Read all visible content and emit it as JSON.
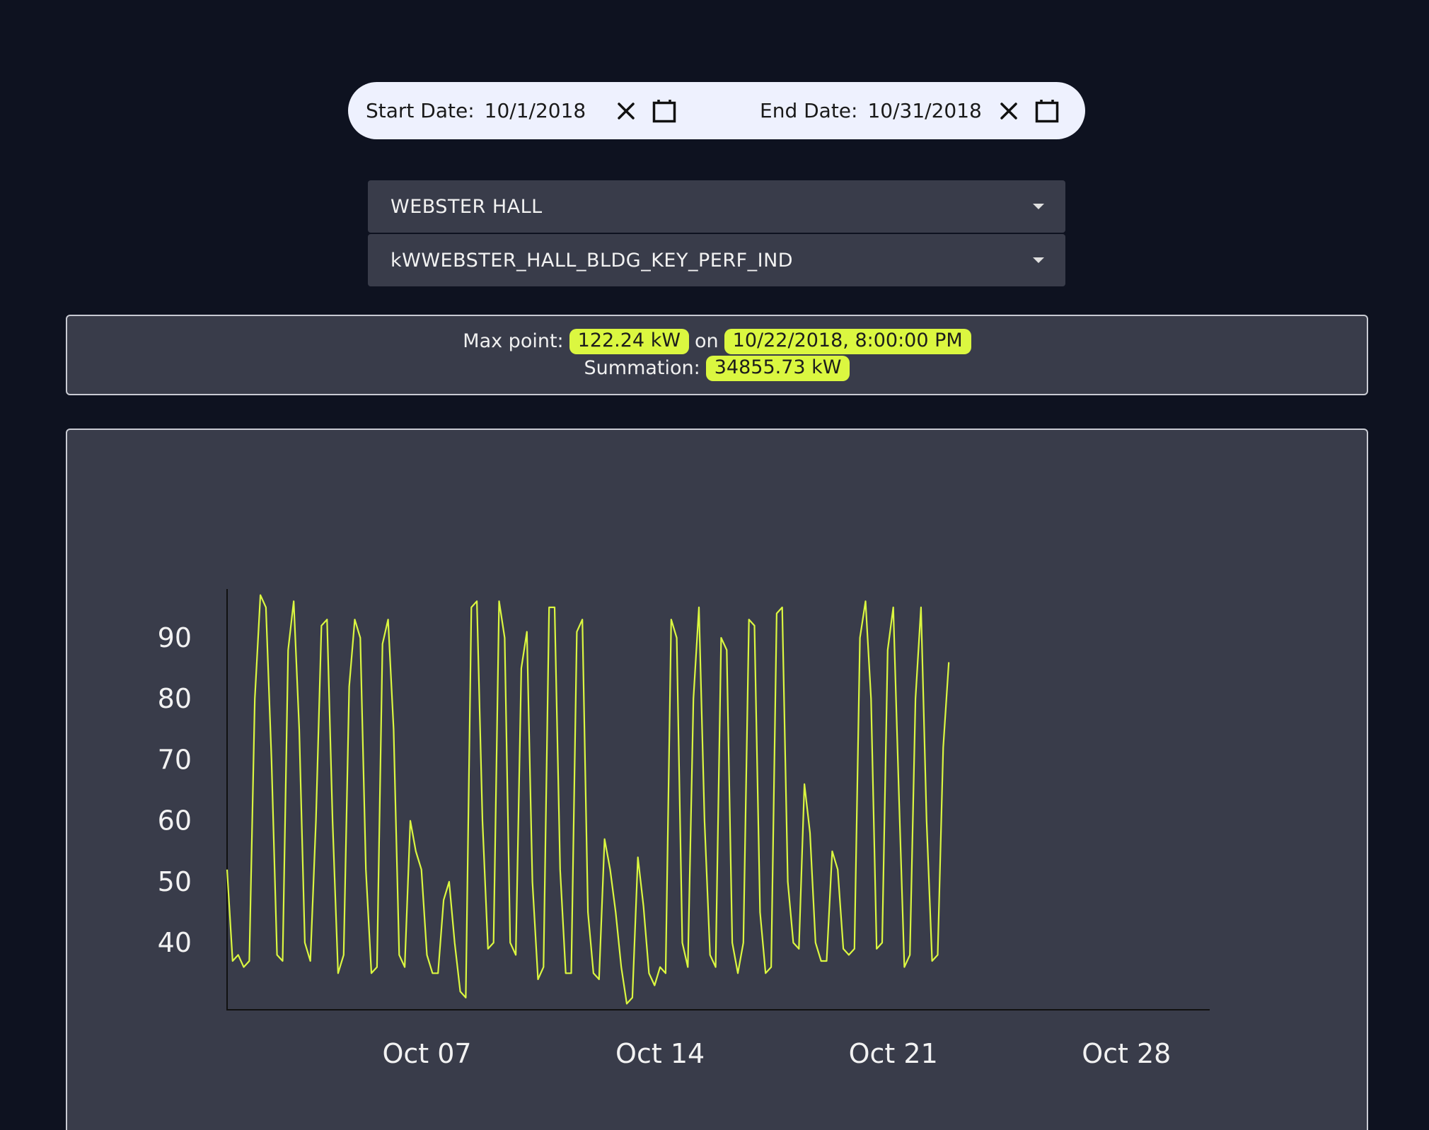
{
  "date_range": {
    "start_label": "Start Date:",
    "start_value": "10/1/2018",
    "end_label": "End Date:",
    "end_value": "10/31/2018",
    "icons": [
      "close-icon",
      "calendar-icon"
    ]
  },
  "selects": {
    "building": "WEBSTER HALL",
    "point": "kWWEBSTER_HALL_BLDG_KEY_PERF_IND"
  },
  "summary": {
    "max_label": "Max point:",
    "max_value": "122.24 kW",
    "on_label": "on",
    "max_date": "10/22/2018, 8:00:00 PM",
    "sum_label": "Summation:",
    "sum_value": "34855.73 kW"
  },
  "colors": {
    "accent": "#dbf740",
    "background": "#0e1220",
    "card": "#393c4a"
  },
  "chart_data": {
    "type": "line",
    "title": "",
    "xlabel": "",
    "ylabel": "",
    "ylim": [
      29,
      98
    ],
    "xlim": [
      "2018-10-01T00:00",
      "2018-10-30T12:00"
    ],
    "y_ticks": [
      40,
      50,
      60,
      70,
      80,
      90
    ],
    "x_ticks": [
      {
        "label": "Oct 07",
        "x": "2018-10-07T00:00"
      },
      {
        "label": "Oct 14",
        "x": "2018-10-14T00:00"
      },
      {
        "label": "Oct 21",
        "x": "2018-10-21T00:00"
      },
      {
        "label": "Oct 28",
        "x": "2018-10-28T00:00"
      }
    ],
    "grid": false,
    "series": [
      {
        "color": "#dbf740",
        "points": [
          [
            "2018-10-01T00:00",
            52
          ],
          [
            "2018-10-01T04:00",
            37
          ],
          [
            "2018-10-01T08:00",
            38
          ],
          [
            "2018-10-01T12:00",
            36
          ],
          [
            "2018-10-01T16:00",
            37
          ],
          [
            "2018-10-01T20:00",
            80
          ],
          [
            "2018-10-02T00:00",
            97
          ],
          [
            "2018-10-02T04:00",
            95
          ],
          [
            "2018-10-02T08:00",
            70
          ],
          [
            "2018-10-02T12:00",
            38
          ],
          [
            "2018-10-02T16:00",
            37
          ],
          [
            "2018-10-02T20:00",
            88
          ],
          [
            "2018-10-03T00:00",
            96
          ],
          [
            "2018-10-03T04:00",
            75
          ],
          [
            "2018-10-03T08:00",
            40
          ],
          [
            "2018-10-03T12:00",
            37
          ],
          [
            "2018-10-03T16:00",
            60
          ],
          [
            "2018-10-03T20:00",
            92
          ],
          [
            "2018-10-04T00:00",
            93
          ],
          [
            "2018-10-04T04:00",
            60
          ],
          [
            "2018-10-04T08:00",
            35
          ],
          [
            "2018-10-04T12:00",
            38
          ],
          [
            "2018-10-04T16:00",
            82
          ],
          [
            "2018-10-04T20:00",
            93
          ],
          [
            "2018-10-05T00:00",
            90
          ],
          [
            "2018-10-05T04:00",
            52
          ],
          [
            "2018-10-05T08:00",
            35
          ],
          [
            "2018-10-05T12:00",
            36
          ],
          [
            "2018-10-05T16:00",
            89
          ],
          [
            "2018-10-05T20:00",
            93
          ],
          [
            "2018-10-06T00:00",
            75
          ],
          [
            "2018-10-06T04:00",
            38
          ],
          [
            "2018-10-06T08:00",
            36
          ],
          [
            "2018-10-06T12:00",
            60
          ],
          [
            "2018-10-06T16:00",
            55
          ],
          [
            "2018-10-06T20:00",
            52
          ],
          [
            "2018-10-07T00:00",
            38
          ],
          [
            "2018-10-07T04:00",
            35
          ],
          [
            "2018-10-07T08:00",
            35
          ],
          [
            "2018-10-07T12:00",
            47
          ],
          [
            "2018-10-07T16:00",
            50
          ],
          [
            "2018-10-07T20:00",
            40
          ],
          [
            "2018-10-08T00:00",
            32
          ],
          [
            "2018-10-08T04:00",
            31
          ],
          [
            "2018-10-08T08:00",
            95
          ],
          [
            "2018-10-08T12:00",
            96
          ],
          [
            "2018-10-08T16:00",
            60
          ],
          [
            "2018-10-08T20:00",
            39
          ],
          [
            "2018-10-09T00:00",
            40
          ],
          [
            "2018-10-09T04:00",
            96
          ],
          [
            "2018-10-09T08:00",
            90
          ],
          [
            "2018-10-09T12:00",
            40
          ],
          [
            "2018-10-09T16:00",
            38
          ],
          [
            "2018-10-09T20:00",
            85
          ],
          [
            "2018-10-10T00:00",
            91
          ],
          [
            "2018-10-10T04:00",
            50
          ],
          [
            "2018-10-10T08:00",
            34
          ],
          [
            "2018-10-10T12:00",
            36
          ],
          [
            "2018-10-10T16:00",
            95
          ],
          [
            "2018-10-10T20:00",
            95
          ],
          [
            "2018-10-11T00:00",
            52
          ],
          [
            "2018-10-11T04:00",
            35
          ],
          [
            "2018-10-11T08:00",
            35
          ],
          [
            "2018-10-11T12:00",
            91
          ],
          [
            "2018-10-11T16:00",
            93
          ],
          [
            "2018-10-11T20:00",
            45
          ],
          [
            "2018-10-12T00:00",
            35
          ],
          [
            "2018-10-12T04:00",
            34
          ],
          [
            "2018-10-12T08:00",
            57
          ],
          [
            "2018-10-12T12:00",
            52
          ],
          [
            "2018-10-12T16:00",
            45
          ],
          [
            "2018-10-12T20:00",
            36
          ],
          [
            "2018-10-13T00:00",
            30
          ],
          [
            "2018-10-13T04:00",
            31
          ],
          [
            "2018-10-13T08:00",
            54
          ],
          [
            "2018-10-13T12:00",
            46
          ],
          [
            "2018-10-13T16:00",
            35
          ],
          [
            "2018-10-13T20:00",
            33
          ],
          [
            "2018-10-14T00:00",
            36
          ],
          [
            "2018-10-14T04:00",
            35
          ],
          [
            "2018-10-14T08:00",
            93
          ],
          [
            "2018-10-14T12:00",
            90
          ],
          [
            "2018-10-14T16:00",
            40
          ],
          [
            "2018-10-14T20:00",
            36
          ],
          [
            "2018-10-15T00:00",
            80
          ],
          [
            "2018-10-15T04:00",
            95
          ],
          [
            "2018-10-15T08:00",
            60
          ],
          [
            "2018-10-15T12:00",
            38
          ],
          [
            "2018-10-15T16:00",
            36
          ],
          [
            "2018-10-15T20:00",
            90
          ],
          [
            "2018-10-16T00:00",
            88
          ],
          [
            "2018-10-16T04:00",
            40
          ],
          [
            "2018-10-16T08:00",
            35
          ],
          [
            "2018-10-16T12:00",
            40
          ],
          [
            "2018-10-16T16:00",
            93
          ],
          [
            "2018-10-16T20:00",
            92
          ],
          [
            "2018-10-17T00:00",
            45
          ],
          [
            "2018-10-17T04:00",
            35
          ],
          [
            "2018-10-17T08:00",
            36
          ],
          [
            "2018-10-17T12:00",
            94
          ],
          [
            "2018-10-17T16:00",
            95
          ],
          [
            "2018-10-17T20:00",
            50
          ],
          [
            "2018-10-18T00:00",
            40
          ],
          [
            "2018-10-18T04:00",
            39
          ],
          [
            "2018-10-18T08:00",
            66
          ],
          [
            "2018-10-18T12:00",
            58
          ],
          [
            "2018-10-18T16:00",
            40
          ],
          [
            "2018-10-18T20:00",
            37
          ],
          [
            "2018-10-19T00:00",
            37
          ],
          [
            "2018-10-19T04:00",
            55
          ],
          [
            "2018-10-19T08:00",
            52
          ],
          [
            "2018-10-19T12:00",
            39
          ],
          [
            "2018-10-19T16:00",
            38
          ],
          [
            "2018-10-19T20:00",
            39
          ],
          [
            "2018-10-20T00:00",
            90
          ],
          [
            "2018-10-20T04:00",
            96
          ],
          [
            "2018-10-20T08:00",
            80
          ],
          [
            "2018-10-20T12:00",
            39
          ],
          [
            "2018-10-20T16:00",
            40
          ],
          [
            "2018-10-20T20:00",
            88
          ],
          [
            "2018-10-21T00:00",
            95
          ],
          [
            "2018-10-21T04:00",
            65
          ],
          [
            "2018-10-21T08:00",
            36
          ],
          [
            "2018-10-21T12:00",
            38
          ],
          [
            "2018-10-21T16:00",
            80
          ],
          [
            "2018-10-21T20:00",
            95
          ],
          [
            "2018-10-22T00:00",
            60
          ],
          [
            "2018-10-22T04:00",
            37
          ],
          [
            "2018-10-22T08:00",
            38
          ],
          [
            "2018-10-22T12:00",
            72
          ],
          [
            "2018-10-22T16:00",
            86
          ]
        ]
      }
    ]
  }
}
